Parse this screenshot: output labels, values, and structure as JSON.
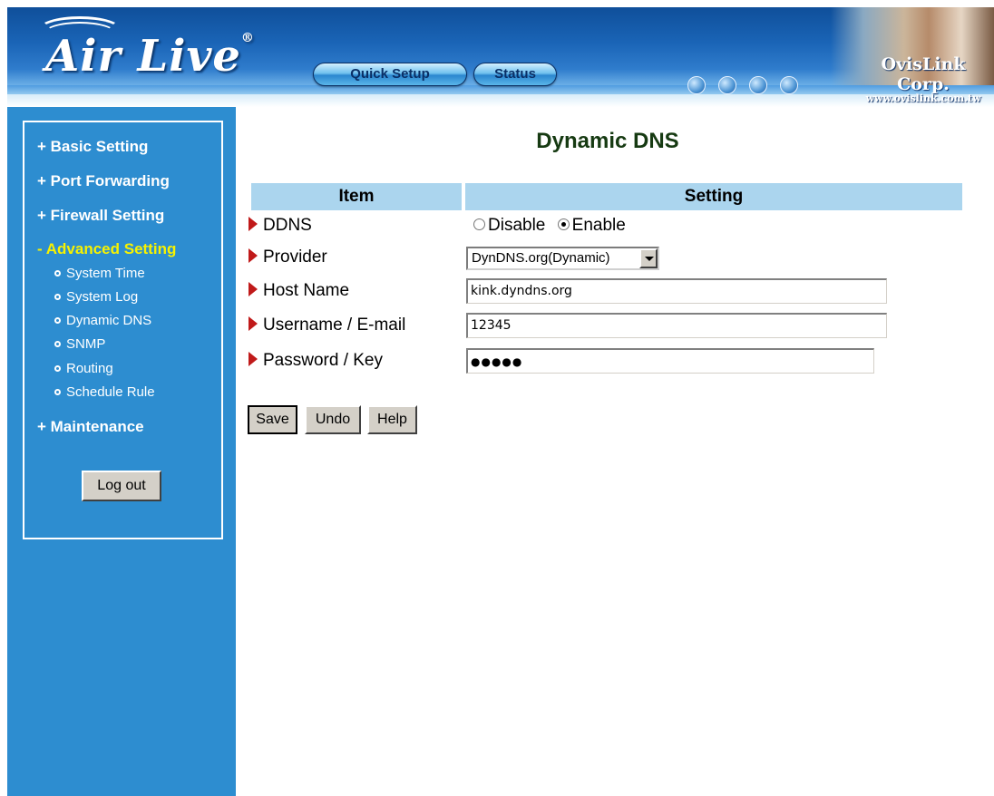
{
  "header": {
    "logo": "Air Live",
    "logo_mark": "®",
    "quick_setup": "Quick Setup",
    "status": "Status",
    "brand_name": "OvisLink Corp.",
    "brand_url": "www.ovislink.com.tw",
    "globe_icons": [
      "globe-icon",
      "globe-icon",
      "globe-icon",
      "globe-icon"
    ]
  },
  "sidebar": {
    "items": [
      {
        "label": "+ Basic Setting"
      },
      {
        "label": "+ Port Forwarding"
      },
      {
        "label": "+ Firewall Setting"
      },
      {
        "label": "- Advanced Setting",
        "active": true
      },
      {
        "label": "+ Maintenance"
      }
    ],
    "subitems": [
      "System Time",
      "System Log",
      "Dynamic DNS",
      "SNMP",
      "Routing",
      "Schedule Rule"
    ],
    "logout": "Log out"
  },
  "main": {
    "title": "Dynamic DNS",
    "col_item": "Item",
    "col_setting": "Setting",
    "ddns": {
      "label": "DDNS",
      "opt_disable": "Disable",
      "opt_enable": "Enable",
      "selected": "Enable"
    },
    "provider": {
      "label": "Provider",
      "value": "DynDNS.org(Dynamic)"
    },
    "host": {
      "label": "Host Name",
      "value": "kink.dyndns.org"
    },
    "username": {
      "label": "Username / E-mail",
      "value": "12345"
    },
    "password": {
      "label": "Password / Key",
      "value": "●●●●●"
    },
    "buttons": {
      "save": "Save",
      "undo": "Undo",
      "help": "Help"
    }
  },
  "colors": {
    "accent": "#2d8dd0",
    "active_nav": "#f7f200",
    "title": "#163a12",
    "header_row": "#abd5ee",
    "arrow": "#c01a1a"
  }
}
